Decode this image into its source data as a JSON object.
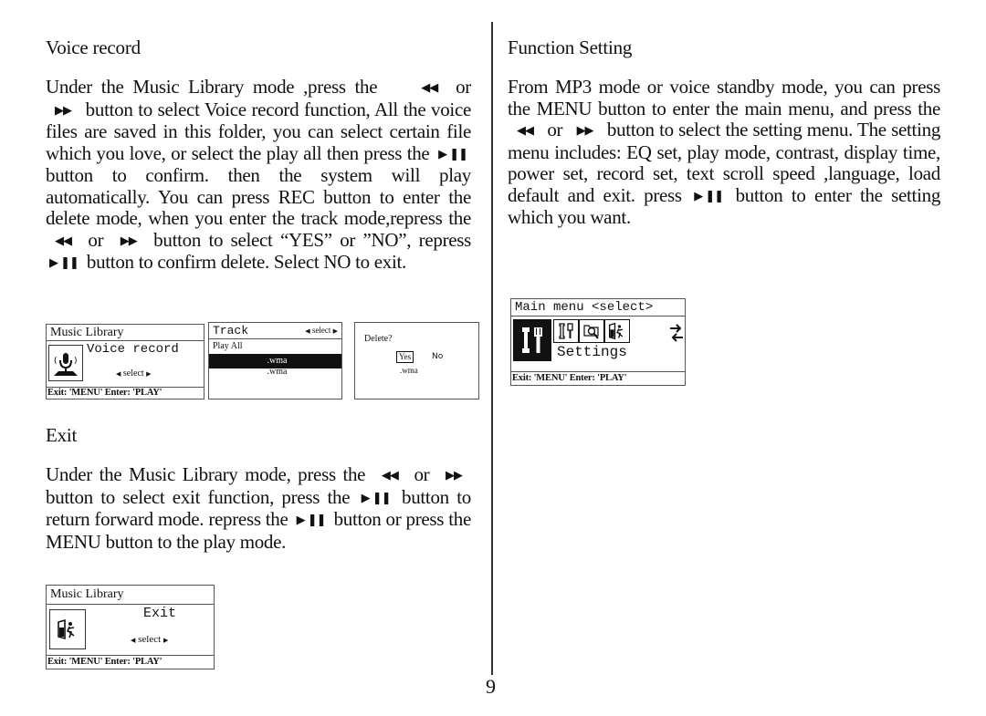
{
  "page_number": "9",
  "left": {
    "voice_record": {
      "heading": "Voice record",
      "body": [
        "Under the Music Library mode ,press the",
        "or",
        "button to select Voice record function, All the voice files are saved in this folder, you can select certain file which you love, or select the play all then press the",
        "button to confirm. then the system will play automatically. You can press REC button to enter the delete mode, when you enter the track mode,repress the",
        "or",
        "button to select “YES” or ”NO”, repress",
        "button to confirm delete. Select NO to exit."
      ]
    },
    "screen_music_library": {
      "title": "Music Library",
      "item": "Voice record",
      "icon": "microphone-icon",
      "select": "select",
      "footer": "Exit: 'MENU' Enter: 'PLAY'"
    },
    "screen_track": {
      "title": "Track",
      "select": "select",
      "rows": [
        "Play All",
        ".wma",
        ".wma"
      ],
      "highlighted_index": 1
    },
    "screen_delete": {
      "prompt": "Delete?",
      "yes": "Yes",
      "no": "No",
      "file": ".wma"
    },
    "exit": {
      "heading": "Exit",
      "body": [
        "Under the Music Library mode, press the",
        "or",
        "button to select exit function, press the",
        "button to return forward mode. repress the",
        "button or press the MENU button to the play mode."
      ]
    },
    "screen_exit": {
      "title": "Music Library",
      "item": "Exit",
      "icon": "exit-door-icon",
      "select": "select",
      "footer": "Exit: 'MENU' Enter: 'PLAY'"
    }
  },
  "right": {
    "function_setting": {
      "heading": "Function Setting",
      "body": [
        "From MP3 mode or voice standby mode, you can press the MENU button to enter the main menu, and press the",
        "or",
        "button to select the setting menu. The setting menu includes: EQ set, play mode, contrast, display time, power set, record set, text scroll speed ,language, load default and exit. press",
        "button to enter the setting which you want."
      ]
    },
    "screen_main_menu": {
      "title": "Main menu <select>",
      "icons": [
        "settings-icon",
        "tools-icon",
        "search-icon",
        "exit-door-icon",
        "switch-arrows-icon"
      ],
      "item": "Settings",
      "footer": "Exit: 'MENU' Enter: 'PLAY'"
    }
  },
  "glyphs": {
    "rewind": "◀◀",
    "forward": "▶▶",
    "play_pause": "▶ ❚❚",
    "tri_left": "◀",
    "tri_right": "▶"
  }
}
